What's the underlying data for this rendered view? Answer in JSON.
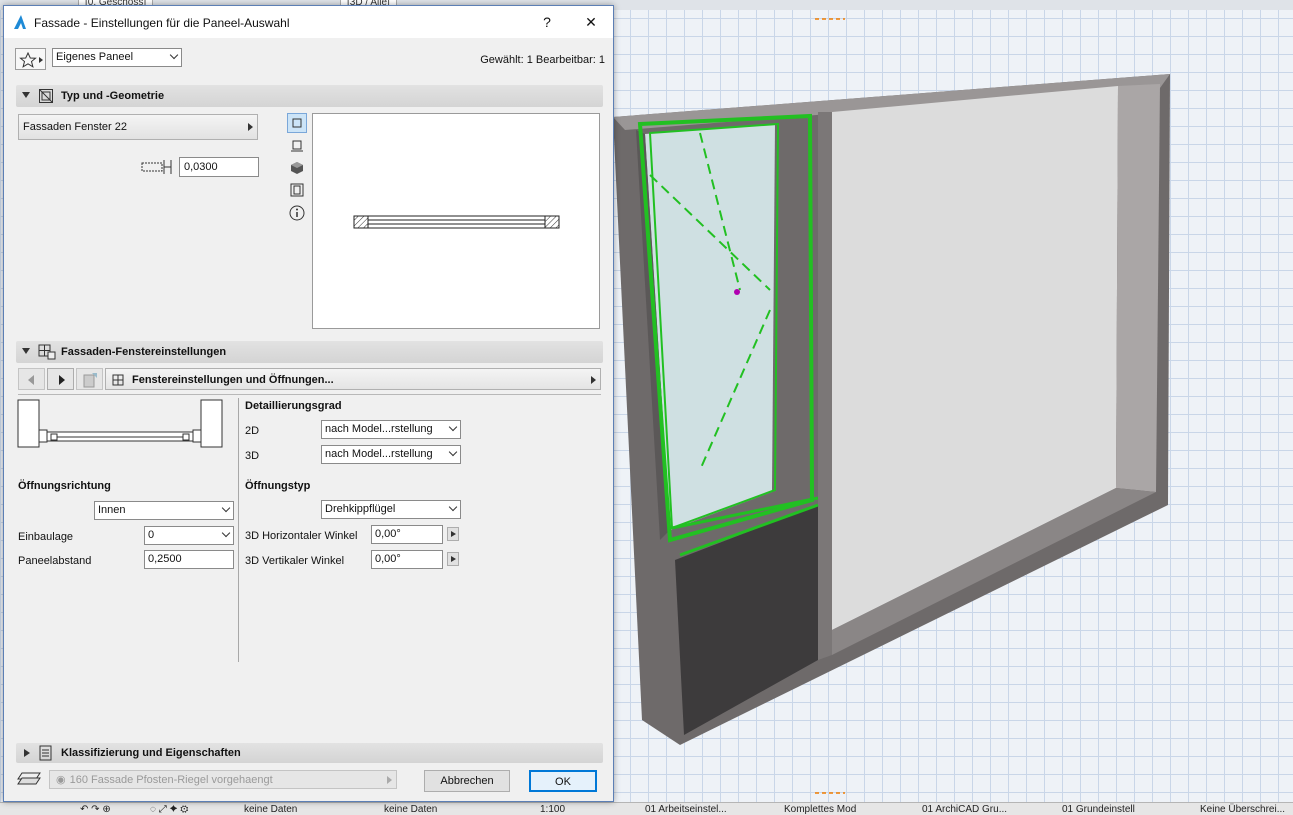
{
  "background": {
    "tab_left": "[0. Geschoss]",
    "tab_right": "[3D / Alle]",
    "bottom_bar": {
      "zoom_none_1": "keine Daten",
      "zoom_none_2": "keine Daten",
      "scale": "1:100",
      "layer_combo": "01 Arbeitseinstel...",
      "model_view": "Komplettes Mod",
      "pen_set": "01 ArchiCAD Gru...",
      "dimension": "01 Grundeinstell",
      "renovation": "Keine Überschrei..."
    }
  },
  "dialog": {
    "title": "Fassade - Einstellungen für die Paneel-Auswahl",
    "help_label": "?",
    "close_label": "✕",
    "favorites_selector": "Eigenes Paneel",
    "selection_info": "Gewählt: 1 Bearbeitbar: 1",
    "section_type_geometry": {
      "title": "Typ und -Geometrie",
      "panel_type": "Fassaden Fenster 22",
      "thickness_value": "0,0300"
    },
    "section_window_settings": {
      "title": "Fassaden-Fenstereinstellungen",
      "page_selector": "Fenstereinstellungen und Öffnungen...",
      "detail_level_label": "Detaillierungsgrad",
      "label_2d": "2D",
      "value_2d": "nach Model...rstellung",
      "label_3d": "3D",
      "value_3d": "nach Model...rstellung",
      "opening_direction_label": "Öffnungsrichtung",
      "opening_direction_value": "Innen",
      "opening_type_label": "Öffnungstyp",
      "opening_type_value": "Drehkippflügel",
      "installation_label": "Einbaulage",
      "installation_value": "0",
      "panel_distance_label": "Paneelabstand",
      "panel_distance_value": "0,2500",
      "h_angle_label": "3D Horizontaler Winkel",
      "h_angle_value": "0,00°",
      "v_angle_label": "3D Vertikaler Winkel",
      "v_angle_value": "0,00°"
    },
    "section_classification": {
      "title": "Klassifizierung und Eigenschaften"
    },
    "layer_value": "160 Fassade Pfosten-Riegel vorgehaengt",
    "cancel_label": "Abbrechen",
    "ok_label": "OK"
  }
}
